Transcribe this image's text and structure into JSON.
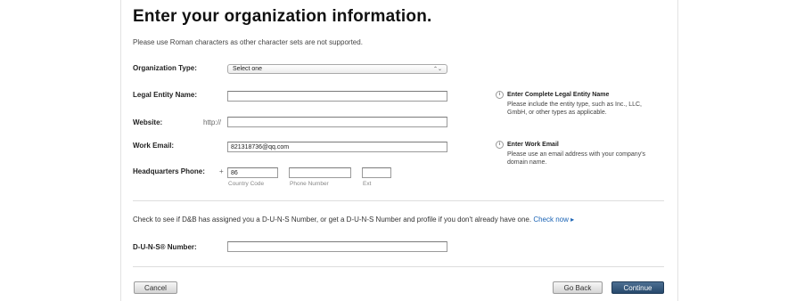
{
  "page": {
    "title": "Enter your organization information.",
    "subtitle": "Please use Roman characters as other character sets are not supported."
  },
  "form": {
    "org_type": {
      "label": "Organization Type:",
      "selected": "Select one",
      "chevron": "⌃⌄"
    },
    "legal_name": {
      "label": "Legal Entity Name:",
      "value": ""
    },
    "website": {
      "label": "Website:",
      "prefix": "http://",
      "value": ""
    },
    "work_email": {
      "label": "Work Email:",
      "value": "821318736@qq.com"
    },
    "hq_phone": {
      "label": "Headquarters Phone:",
      "plus": "+",
      "country_code": "86",
      "phone_number": "",
      "ext": "",
      "hint_country": "Country Code",
      "hint_phone": "Phone Number",
      "hint_ext": "Ext"
    },
    "duns": {
      "label": "D-U-N-S® Number:",
      "value": ""
    }
  },
  "info": {
    "legal": {
      "title": "Enter Complete Legal Entity Name",
      "line1": "Please include the entity type, such as Inc., LLC,",
      "line2": "GmbH, or other types as applicable."
    },
    "email": {
      "title": "Enter Work Email",
      "line1": "Please use an email address with your company's",
      "line2": "domain name."
    }
  },
  "duns_check": {
    "text": "Check to see if D&B has assigned you a D-U-N-S Number, or get a D-U-N-S Number and profile if you don't already have one.",
    "link": "Check now ▸"
  },
  "buttons": {
    "cancel": "Cancel",
    "go_back": "Go Back",
    "continue": "Continue"
  },
  "icons": {
    "info": "i"
  }
}
